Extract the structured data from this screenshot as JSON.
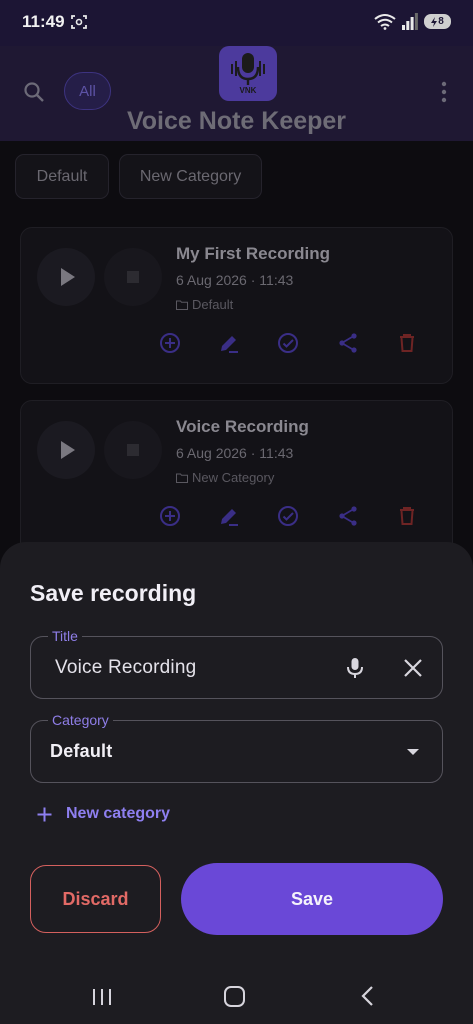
{
  "status_bar": {
    "time": "11:49",
    "battery_level": "8",
    "icons": [
      "screenshot-capture-icon",
      "wifi-icon",
      "signal-icon",
      "battery-charging-icon"
    ]
  },
  "app_bar": {
    "filter_chip": "All",
    "logo_text": "VNK",
    "title": "Voice Note Keeper",
    "icons": [
      "search-icon",
      "more-vert-icon",
      "microphone-logo-icon"
    ]
  },
  "categories": [
    {
      "label": "Default"
    },
    {
      "label": "New Category"
    }
  ],
  "recordings": [
    {
      "title": "My First Recording",
      "date": "6 Aug 2026 · 11:43",
      "category": "Default"
    },
    {
      "title": "Voice Recording",
      "date": "6 Aug 2026 · 11:43",
      "category": "New Category"
    }
  ],
  "card_actions": [
    "add-circle-icon",
    "edit-icon",
    "check-circle-icon",
    "share-icon",
    "delete-icon"
  ],
  "sheet": {
    "title": "Save recording",
    "title_field": {
      "label": "Title",
      "value": "Voice Recording"
    },
    "category_field": {
      "label": "Category",
      "value": "Default"
    },
    "new_category_label": "New category",
    "discard_label": "Discard",
    "save_label": "Save"
  },
  "colors": {
    "accent": "#6a48d7",
    "accent_text": "#8e7ff0",
    "danger": "#e26a66",
    "sheet_bg": "#1d1c21",
    "app_bar_bg": "#1f1833"
  }
}
